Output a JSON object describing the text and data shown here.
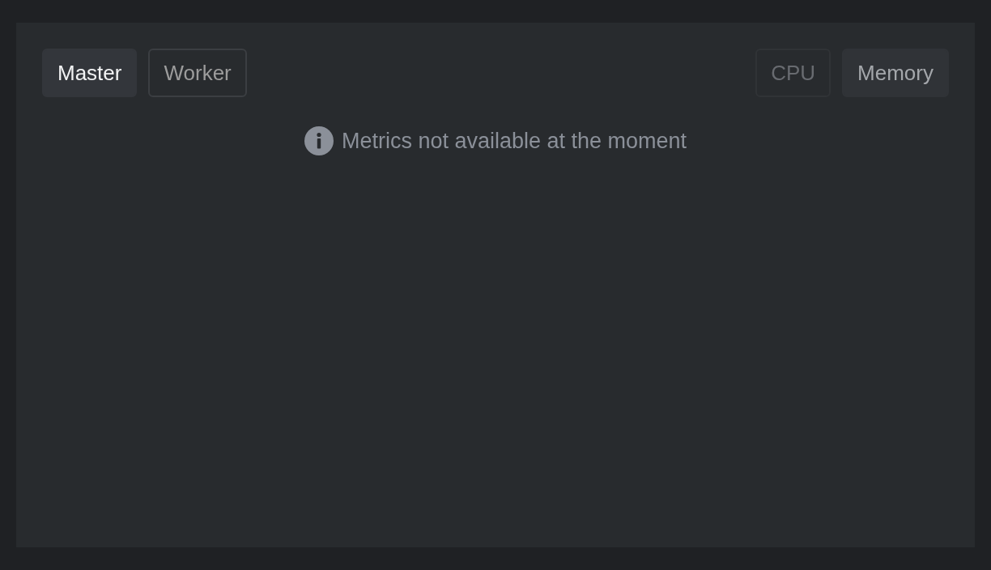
{
  "tab_groups": [
    {
      "disabled": false,
      "tabs": [
        {
          "label": "Master",
          "selected": true
        },
        {
          "label": "Worker",
          "selected": false
        }
      ]
    },
    {
      "disabled": true,
      "tabs": [
        {
          "label": "CPU",
          "selected": false
        },
        {
          "label": "Memory",
          "selected": true
        }
      ]
    }
  ],
  "message": {
    "kind": "info",
    "text": "Metrics not available at the moment"
  }
}
